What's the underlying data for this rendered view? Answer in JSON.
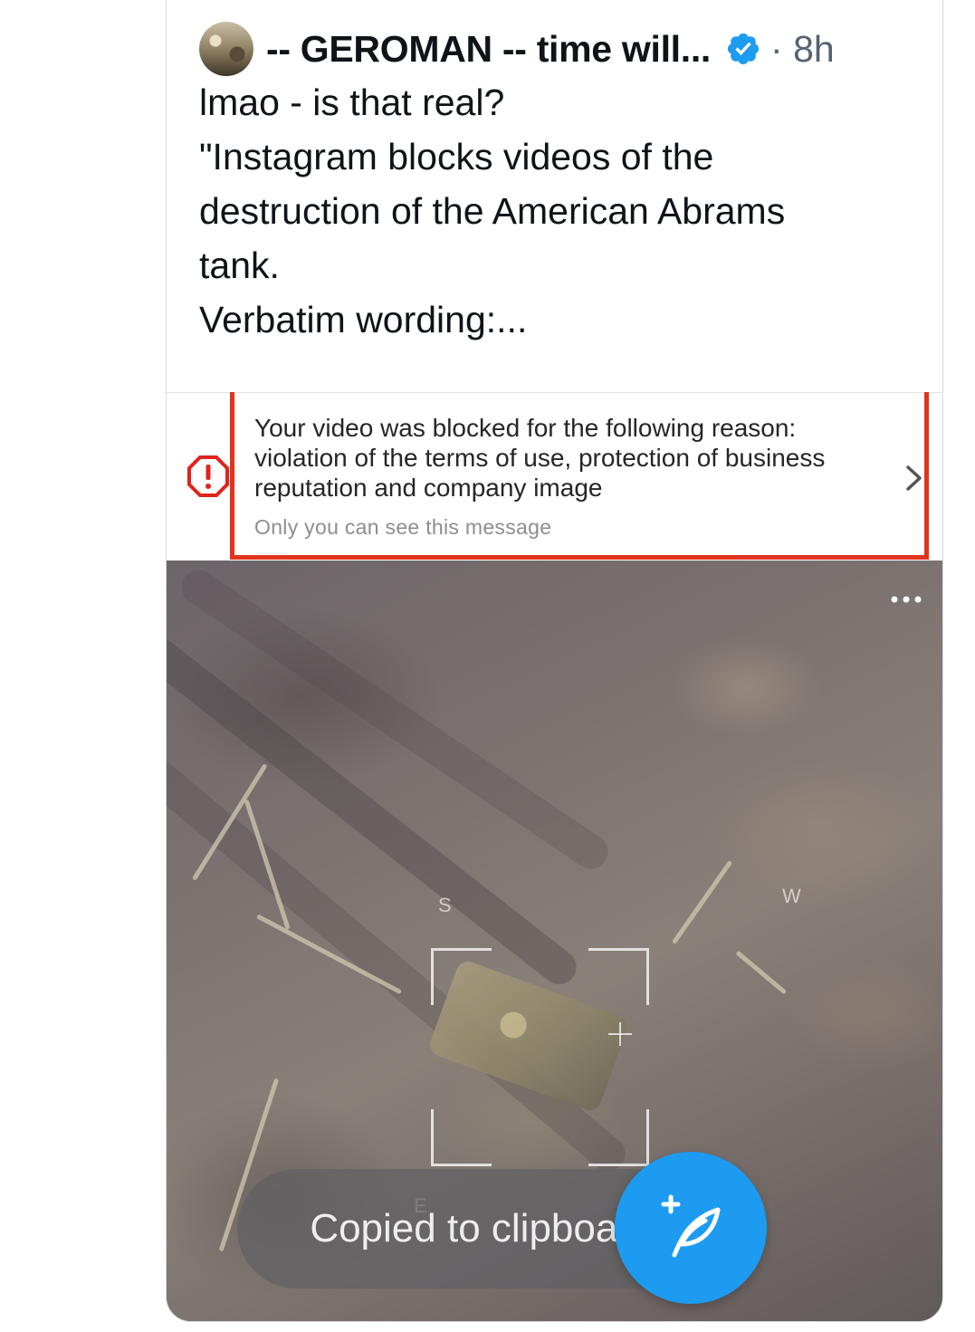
{
  "tweet": {
    "author_name": "-- GEROMAN -- time will...",
    "time_sep": "· 8h",
    "text_lines": [
      "lmao - is that real?",
      "\"Instagram blocks videos of the",
      "destruction of the American Abrams",
      "tank.",
      "Verbatim wording:..."
    ]
  },
  "notice": {
    "lines": [
      "Your video was blocked for the following reason:",
      "violation of the terms of use, protection of business",
      "reputation and company image"
    ],
    "sub": "Only you can see this message",
    "frame_color": "#e0341c"
  },
  "photo": {
    "compass_s": "S",
    "compass_w": "W",
    "compass_e": "E"
  },
  "toast": {
    "text": "Copied to clipboard."
  },
  "icons": {
    "verified": "verified-badge-icon",
    "alert": "alert-octagon-icon",
    "chevron": "chevron-right-icon",
    "more": "more-dots-icon",
    "compose": "compose-feather-icon"
  },
  "colors": {
    "accent": "#1d9bf0",
    "text": "#0f1419",
    "muted": "#536471"
  }
}
